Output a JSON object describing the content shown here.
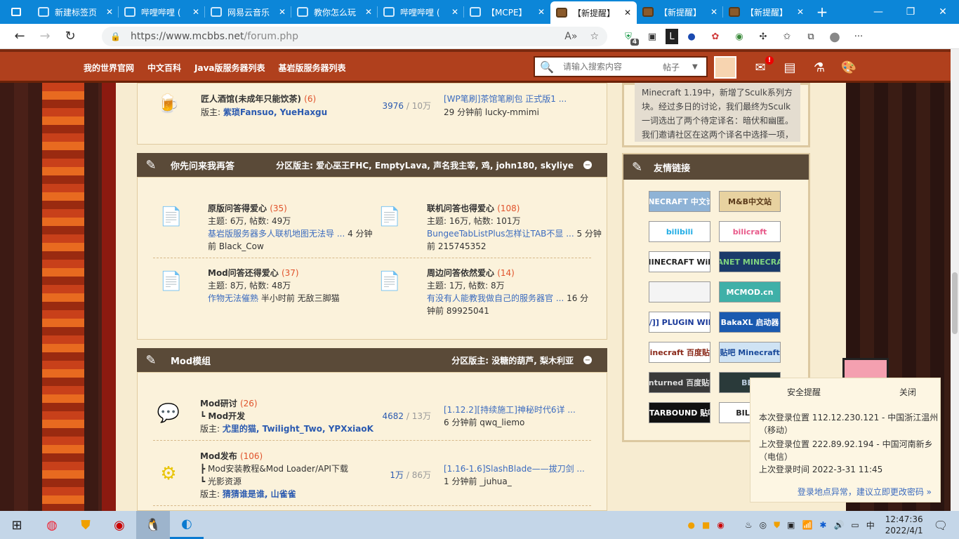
{
  "browser": {
    "tabs": [
      {
        "title": "新建标签页",
        "favicon": "new-tab-icon"
      },
      {
        "title": "哔哩哔哩 (",
        "favicon": "bilibili-icon"
      },
      {
        "title": "网易云音乐",
        "favicon": "bilibili-icon"
      },
      {
        "title": "教你怎么玩",
        "favicon": "bilibili-icon"
      },
      {
        "title": "哔哩哔哩 (",
        "favicon": "bilibili-icon"
      },
      {
        "title": "【MCPE】",
        "favicon": "bilibili-icon"
      },
      {
        "title": "【新提醒】",
        "favicon": "mcbbs-icon",
        "active": true
      },
      {
        "title": "【新提醒】",
        "favicon": "mcbbs-icon"
      },
      {
        "title": "【新提醒】",
        "favicon": "mcbbs-icon"
      }
    ],
    "url_prefix": "https://www.mcbbs.net",
    "url_path": "/forum.php",
    "ext_badge": "4"
  },
  "sitenav": {
    "links": [
      "我的世界官网",
      "中文百科",
      "Java版服务器列表",
      "基岩版服务器列表"
    ],
    "search_placeholder": "请输入搜索内容",
    "search_scope": "帖子",
    "notify_badge": "!"
  },
  "top_forum": {
    "name": "匠人酒馆(未成年只能饮茶)",
    "count": "(6)",
    "mods_label": "版主:",
    "mods": "紫琐Fansuo, YueHaxgu",
    "threads": "3976",
    "posts": "10万",
    "last_title": "[WP笔刷]茶馆笔刷包 正式版1 ...",
    "last_time": "29 分钟前 lucky-mmimi"
  },
  "section_qa": {
    "title": "你先问来我再答",
    "mods": "分区版主: 爱心巫王FHC, EmptyLava, 声名我主宰, 鸡, john180, skyliye",
    "forums": [
      {
        "name": "原版问答得爱心",
        "count": "(35)",
        "stats": "主题: 6万, 帖数: 49万",
        "last_title": "基岩版服务器多人联机地图无法导 ...",
        "last_time_a": "4 分钟",
        "last_time_b": "前 Black_Cow"
      },
      {
        "name": "联机问答也得爱心",
        "count": "(108)",
        "stats": "主题: 16万, 帖数: 101万",
        "last_title": "BungeeTabListPlus怎样让TAB不显 ...",
        "last_time_a": "5 分钟",
        "last_time_b": "前 215745352"
      },
      {
        "name": "Mod问答还得爱心",
        "count": "(37)",
        "stats": "主题: 8万, 帖数: 48万",
        "last_title": "作物无法催熟",
        "last_time_a": "半小时前 无敌三脚猫",
        "last_time_b": ""
      },
      {
        "name": "周边问答依然爱心",
        "count": "(14)",
        "stats": "主题: 1万, 帖数: 8万",
        "last_title": "有没有人能教我做自己的服务器官 ...",
        "last_time_a": "16 分",
        "last_time_b": "钟前 89925041"
      }
    ]
  },
  "section_mod": {
    "title": "Mod模组",
    "mods": "分区版主: 没糖的葫芦, 梨木利亚",
    "forums": [
      {
        "name": "Mod研讨",
        "count": "(26)",
        "sub": [
          "Mod开发"
        ],
        "mods_label": "版主:",
        "mods": "尤里的猫, Twilight_Two, YPXxiaoK",
        "threads": "4682",
        "posts": "13万",
        "last_title": "[1.12.2][持续施工]神秘时代6详 ...",
        "last_time": "6 分钟前 qwq_liemo"
      },
      {
        "name": "Mod发布",
        "count": "(106)",
        "sub": [
          "Mod安装教程&Mod Loader/API下载",
          "光影资源"
        ],
        "mods_label": "版主:",
        "mods": "猜猜谁是谁, 山雀雀",
        "threads": "1万",
        "posts": "86万",
        "last_title": "[1.16-1.6]SlashBlade——拔刀剑 ...",
        "last_time": "1 分钟前 _juhua_"
      }
    ]
  },
  "sidebar": {
    "news_text": [
      "Minecraft 1.19中，新增了Sculk系列方",
      "块。经过多日的讨论，我们最终为Sculk",
      "一词选出了两个待定译名：暗伏和幽匿。",
      "我们邀请社区在这两个译名中选择一项，"
    ],
    "links_title": "友情链接",
    "links": [
      {
        "label": "MINECRAFT 中文论坛",
        "bg": "#8fb3d6",
        "fg": "#fff"
      },
      {
        "label": "M&B中文站",
        "bg": "#e8d2a0",
        "fg": "#5a3a1a"
      },
      {
        "label": "bilibili",
        "bg": "#fff",
        "fg": "#23ade5"
      },
      {
        "label": "bilicraft",
        "bg": "#fff",
        "fg": "#e85a8a"
      },
      {
        "label": "MINECRAFT Wiki",
        "bg": "#fff",
        "fg": "#222"
      },
      {
        "label": "PLANET MINECRAFT",
        "bg": "#1a3a6a",
        "fg": "#7fd47f"
      },
      {
        "label": "",
        "bg": "#f4f4f4",
        "fg": "#a00"
      },
      {
        "label": "MCMOD.cn",
        "bg": "#3fb0a8",
        "fg": "#fff"
      },
      {
        "label": "[[/]] PLUGIN WIKI",
        "bg": "#fff",
        "fg": "#1a3a9a"
      },
      {
        "label": "BakaXL 启动器",
        "bg": "#1a5ab0",
        "fg": "#fff"
      },
      {
        "label": "minecraft 百度贴吧",
        "bg": "#fff",
        "fg": "#8a2a1a"
      },
      {
        "label": "Bai贴吧 Minecraft PE",
        "bg": "#cfe3f4",
        "fg": "#1a4a9a"
      },
      {
        "label": "Unturned 百度贴吧",
        "bg": "#3a3a3a",
        "fg": "#ddd"
      },
      {
        "label": "BES",
        "bg": "#2a3a3a",
        "fg": "#bcd"
      },
      {
        "label": "STARBOUND 贴吧",
        "bg": "#111",
        "fg": "#fff"
      },
      {
        "label": "BIL WI",
        "bg": "#fff",
        "fg": "#222"
      }
    ]
  },
  "security_popup": {
    "title": "安全提醒",
    "close": "关闭",
    "line1": "本次登录位置 112.12.230.121 - 中国浙江温州",
    "line1b": "（移动）",
    "line2": "上次登录位置 222.89.92.194 - 中国河南新乡",
    "line2b": "（电信）",
    "line3": "上次登录时间 2022-3-31 11:45",
    "action": "登录地点异常，建议立即更改密码 »"
  },
  "taskbar": {
    "ime": "中",
    "time": "12:47:36",
    "date": "2022/4/1"
  },
  "colors": {
    "tabbar": "#0c86d8",
    "sitenav": "#b0401d",
    "page_bg": "#f7ecd1",
    "section_head": "#5a4a38",
    "forum_count": "#e0522b",
    "link": "#3b6bbf"
  }
}
